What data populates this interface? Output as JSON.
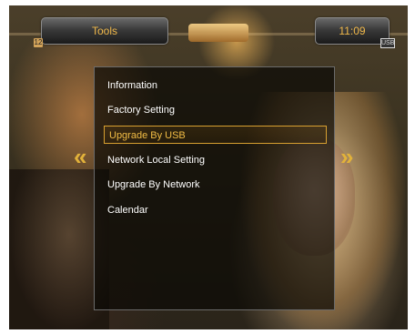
{
  "header": {
    "title": "Tools",
    "time": "11:09"
  },
  "channel": {
    "left_icon": "12",
    "right_icon": "USB"
  },
  "menu": {
    "items": [
      {
        "label": "Information"
      },
      {
        "label": "Factory Setting"
      },
      {
        "label": "Upgrade By USB"
      },
      {
        "label": "Network Local Setting"
      },
      {
        "label": "Upgrade By Network"
      },
      {
        "label": "Calendar"
      }
    ],
    "selected_index": 2
  },
  "nav": {
    "left_arrow": "«",
    "right_arrow": "»"
  },
  "colors": {
    "accent": "#f0b84a",
    "selection_border": "#d8a030",
    "text": "#ffffff"
  },
  "icons": {
    "left_arrow": "double-chevron-left-icon",
    "right_arrow": "double-chevron-right-icon"
  }
}
